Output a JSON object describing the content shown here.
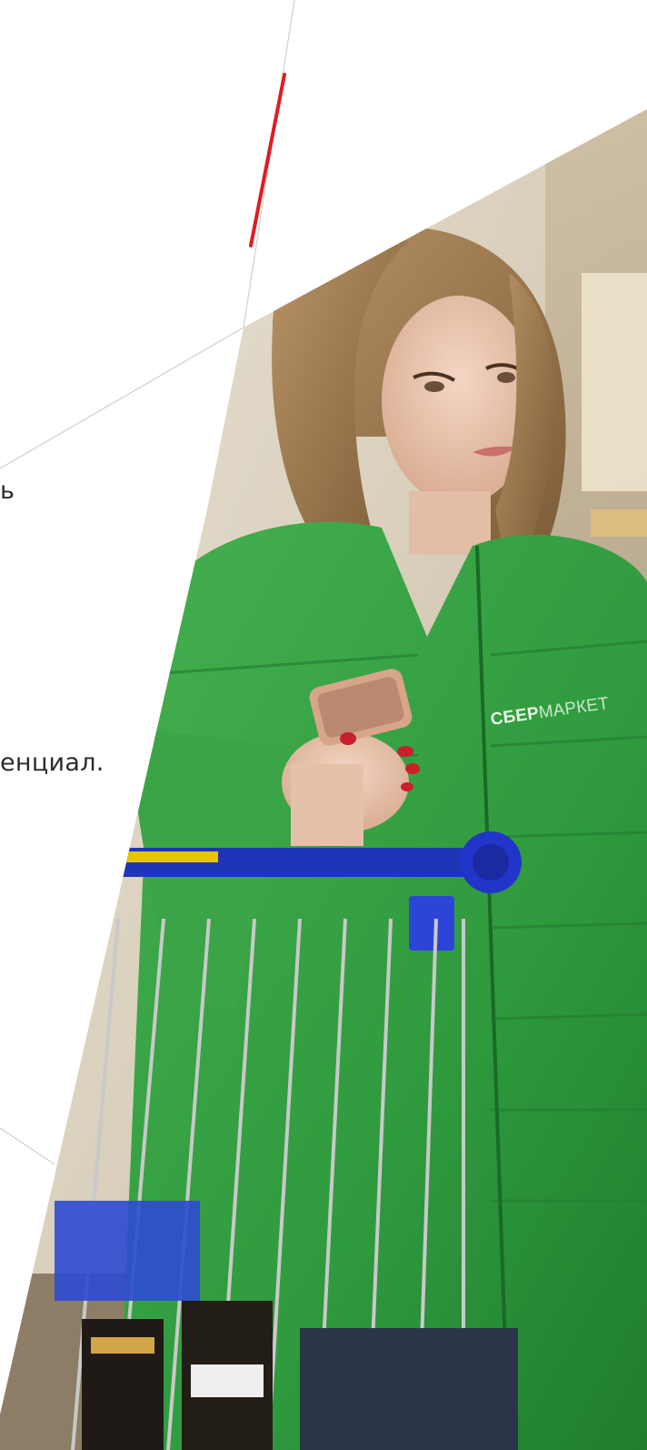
{
  "text_fragments": {
    "line_1": "ь",
    "line_2": "енциал."
  },
  "vest_logo": {
    "bold": "СБЕР",
    "light": "МАРКЕТ"
  },
  "colors": {
    "background": "#ffffff",
    "accent_red": "#e11b22",
    "vest_green": "#2e9e3f",
    "cart_blue": "#1f35b8",
    "text": "#2b2b2b"
  },
  "icons": {
    "decor": "diagonal-lines",
    "phone": "smartphone-icon",
    "cart": "shopping-cart-icon"
  }
}
